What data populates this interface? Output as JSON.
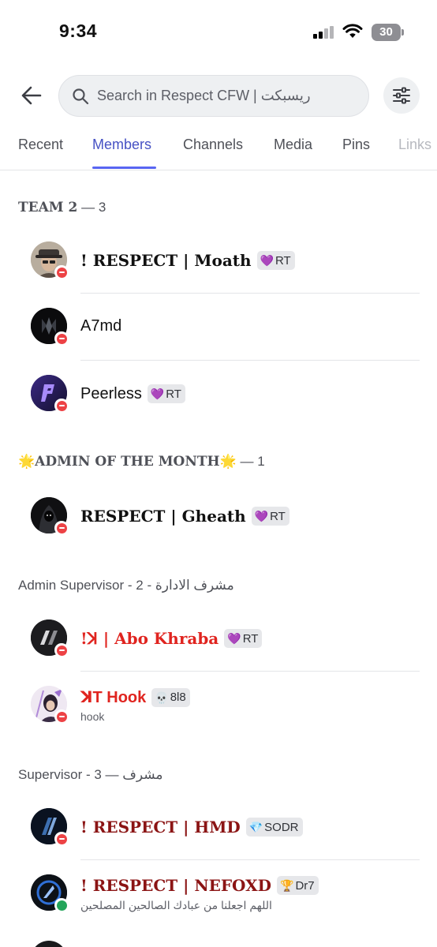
{
  "status_bar": {
    "time": "9:34",
    "battery": "30"
  },
  "search": {
    "placeholder": "Search in Respect CFW | ريسبكت"
  },
  "tabs": [
    {
      "label": "Recent",
      "active": false
    },
    {
      "label": "Members",
      "active": true
    },
    {
      "label": "Channels",
      "active": false
    },
    {
      "label": "Media",
      "active": false
    },
    {
      "label": "Pins",
      "active": false
    },
    {
      "label": "Links",
      "active": false
    }
  ],
  "sections": [
    {
      "title": "TEAM 2",
      "count": "3",
      "members": [
        {
          "name": "!        RESPECT | Moath",
          "tag": "RT",
          "tag_icon": "purple-heart-icon",
          "status": "dnd"
        },
        {
          "name": "A7md",
          "tag": "",
          "status": "dnd"
        },
        {
          "name": "Peerless",
          "tag": "RT",
          "tag_icon": "purple-heart-icon",
          "status": "dnd"
        }
      ]
    },
    {
      "title": "ADMIN OF THE MONTH",
      "count": "1",
      "members": [
        {
          "name": "RESPECT | Gheath",
          "tag": "RT",
          "tag_icon": "purple-heart-icon",
          "status": "dnd"
        }
      ]
    },
    {
      "title": "Admin Supervisor - 2 - مشرف الادارة",
      "members": [
        {
          "name": "!ꓘ | Abo Khraba",
          "tag": "RT",
          "tag_icon": "purple-heart-icon",
          "status": "dnd",
          "color": "#e0241f"
        },
        {
          "name": "ꓘT Hook",
          "tag": "8l8",
          "tag_icon": "skull-icon",
          "subtitle": "hook",
          "status": "dnd",
          "color": "#e0241f"
        }
      ]
    },
    {
      "title": "Supervisor - 3 — مشرف",
      "members": [
        {
          "name": "! RESPECT | HMD",
          "tag": "SODR",
          "tag_icon": "diamond-icon",
          "status": "dnd",
          "color": "#8b1414"
        },
        {
          "name": "! RESPECT | NEFOXD",
          "tag": "Dr7",
          "tag_icon": "trophy-icon",
          "subtitle": "اللهم اجعلنا من عبادك الصالحين المصلحين",
          "status": "online",
          "color": "#8b1414"
        }
      ]
    }
  ],
  "colors": {
    "accent": "#5865f2",
    "dnd": "#ed4245",
    "online": "#23a55a"
  }
}
